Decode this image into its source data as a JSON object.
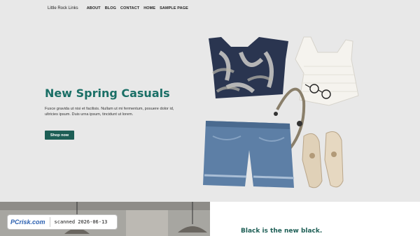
{
  "nav": {
    "brand": "Little Rock Links",
    "items": [
      "About",
      "Blog",
      "Contact",
      "Home",
      "Sample Page"
    ]
  },
  "hero": {
    "headline": "New Spring Casuals",
    "lede": "Fusce gravida ut nisi et facilisis. Nullam ut mi fermentum, posuere dolor id, ultricies ipsum. Duis urna ipsum, tincidunt ut lorem.",
    "cta": "Shop now"
  },
  "section2": {
    "headline": "Black is the new black."
  },
  "badge": {
    "logo": "PCrisk.com",
    "scanned": "scanned 2026-06-13"
  },
  "colors": {
    "accent": "#1a6f66",
    "button": "#1d5e55",
    "hero_bg": "#e8e8e8"
  }
}
